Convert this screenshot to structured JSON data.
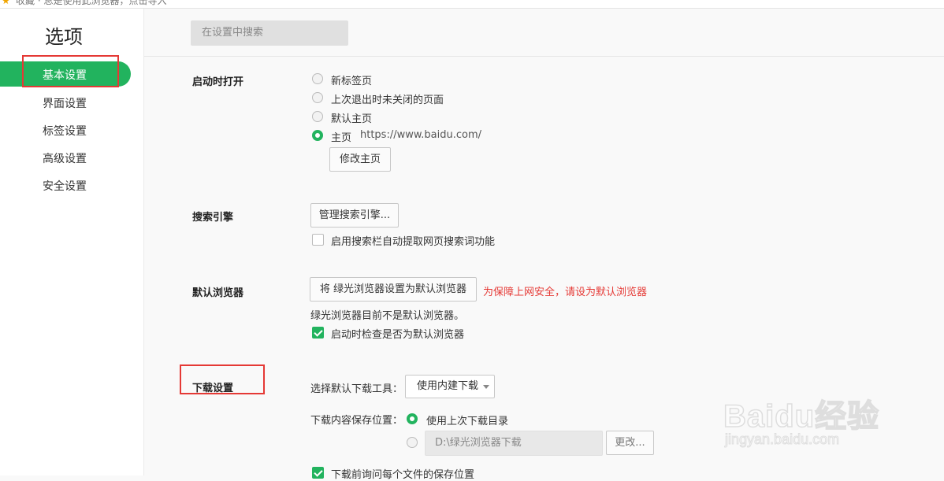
{
  "top_strip": {
    "text": "收藏 · 总是使用此浏览器，点击导入"
  },
  "sidebar": {
    "title": "选项",
    "items": [
      {
        "label": "基本设置",
        "active": true
      },
      {
        "label": "界面设置"
      },
      {
        "label": "标签设置"
      },
      {
        "label": "高级设置"
      },
      {
        "label": "安全设置"
      }
    ]
  },
  "search": {
    "placeholder": "在设置中搜索"
  },
  "startup": {
    "label": "启动时打开",
    "options": [
      {
        "text": "新标签页",
        "selected": false
      },
      {
        "text": "上次退出时未关闭的页面",
        "selected": false
      },
      {
        "text": "默认主页",
        "selected": false
      },
      {
        "text": "主页",
        "selected": true
      }
    ],
    "homepage_url": "https://www.baidu.com/",
    "modify_button": "修改主页"
  },
  "search_engine": {
    "label": "搜索引擎",
    "manage_button": "管理搜索引擎...",
    "auto_extract_label": "启用搜索栏自动提取网页搜索词功能",
    "auto_extract_checked": false
  },
  "default_browser": {
    "label": "默认浏览器",
    "set_button": "将 绿光浏览器设置为默认浏览器",
    "warning": "为保障上网安全，请设为默认浏览器",
    "status": "绿光浏览器目前不是默认浏览器。",
    "check_label": "启动时检查是否为默认浏览器",
    "check_checked": true
  },
  "download": {
    "label": "下载设置",
    "tool_label": "选择默认下载工具：",
    "tool_value": "使用内建下载",
    "location_label": "下载内容保存位置：",
    "use_last_dir": "使用上次下载目录",
    "custom_path": "D:\\绿光浏览器下载",
    "change_button": "更改...",
    "ask_each": "下载前询问每个文件的保存位置",
    "ask_checked": true
  },
  "watermark": {
    "logo": "Baidu经验",
    "url": "jingyan.baidu.com"
  },
  "colors": {
    "accent": "#22b35e",
    "warning": "#e53935",
    "annotation": "#e53935"
  }
}
